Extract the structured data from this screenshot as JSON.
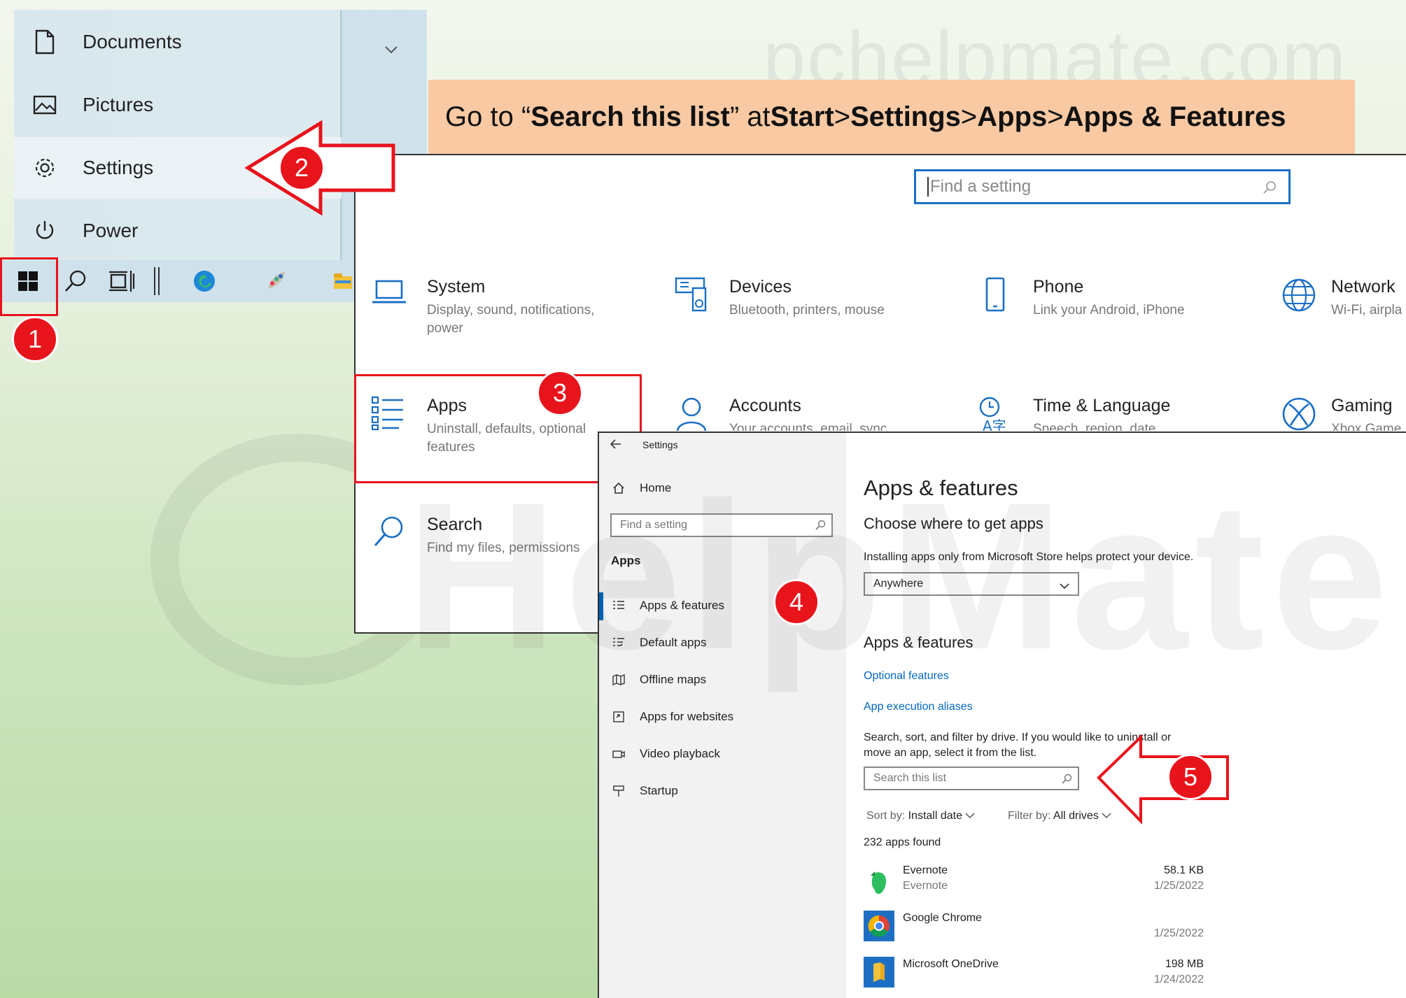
{
  "watermark": {
    "site": "pchelpmate.com",
    "brand": "HelpMate"
  },
  "banner": {
    "prefix": "Go to “",
    "target": "Search this list",
    "mid": "” at ",
    "steps": [
      "Start",
      "Settings",
      "Apps",
      "Apps & Features"
    ],
    "sep": " > "
  },
  "start_menu": {
    "items": [
      {
        "label": "Documents",
        "icon": "document-icon"
      },
      {
        "label": "Pictures",
        "icon": "pictures-icon"
      },
      {
        "label": "Settings",
        "icon": "gear-icon"
      },
      {
        "label": "Power",
        "icon": "power-icon"
      }
    ],
    "expand_icon": "chevron-down-icon"
  },
  "taskbar": {
    "icons": [
      "windows-start-icon",
      "search-icon",
      "task-view-icon",
      "edge-icon",
      "paint-icon",
      "file-explorer-icon"
    ]
  },
  "settings_home": {
    "search_placeholder": "Find a setting",
    "categories": [
      {
        "title": "System",
        "sub": "Display, sound, notifications, power"
      },
      {
        "title": "Devices",
        "sub": "Bluetooth, printers, mouse"
      },
      {
        "title": "Phone",
        "sub": "Link your Android, iPhone"
      },
      {
        "title": "Network",
        "sub": "Wi-Fi, airpla"
      },
      {
        "title": "Apps",
        "sub": "Uninstall, defaults, optional features"
      },
      {
        "title": "Accounts",
        "sub": "Your accounts, email, sync"
      },
      {
        "title": "Time & Language",
        "sub": "Speech, region, date"
      },
      {
        "title": "Gaming",
        "sub": "Xbox Game"
      },
      {
        "title": "Search",
        "sub": "Find my files, permissions"
      }
    ]
  },
  "apps_window": {
    "window_title": "Settings",
    "home_label": "Home",
    "search_placeholder": "Find a setting",
    "section_label": "Apps",
    "nav": [
      {
        "label": "Apps & features",
        "icon": "list-icon"
      },
      {
        "label": "Default apps",
        "icon": "default-apps-icon"
      },
      {
        "label": "Offline maps",
        "icon": "map-icon"
      },
      {
        "label": "Apps for websites",
        "icon": "web-app-icon"
      },
      {
        "label": "Video playback",
        "icon": "video-icon"
      },
      {
        "label": "Startup",
        "icon": "startup-icon"
      }
    ],
    "page_title": "Apps & features",
    "choose_heading": "Choose where to get apps",
    "choose_desc": "Installing apps only from Microsoft Store helps protect your device.",
    "source_value": "Anywhere",
    "features_heading": "Apps & features",
    "optional_link": "Optional features",
    "aliases_link": "App execution aliases",
    "filter_desc_1": "Search, sort, and filter by drive. If you would like to uninstall or",
    "filter_desc_2": "move an app, select it from the list.",
    "list_search_placeholder": "Search this list",
    "sort_label": "Sort by:",
    "sort_value": "Install date",
    "filter_label": "Filter by:",
    "filter_value": "All drives",
    "count_text": "232 apps found",
    "apps": [
      {
        "name": "Evernote",
        "publisher": "Evernote",
        "size": "58.1 KB",
        "date": "1/25/2022"
      },
      {
        "name": "Google Chrome",
        "publisher": "",
        "size": "",
        "date": "1/25/2022"
      },
      {
        "name": "Microsoft OneDrive",
        "publisher": "",
        "size": "198 MB",
        "date": "1/24/2022"
      }
    ]
  },
  "callouts": [
    "1",
    "2",
    "3",
    "4",
    "5"
  ],
  "colors": {
    "accent": "#0067c0",
    "callout": "#e8141c",
    "banner": "#f8c9a3"
  }
}
